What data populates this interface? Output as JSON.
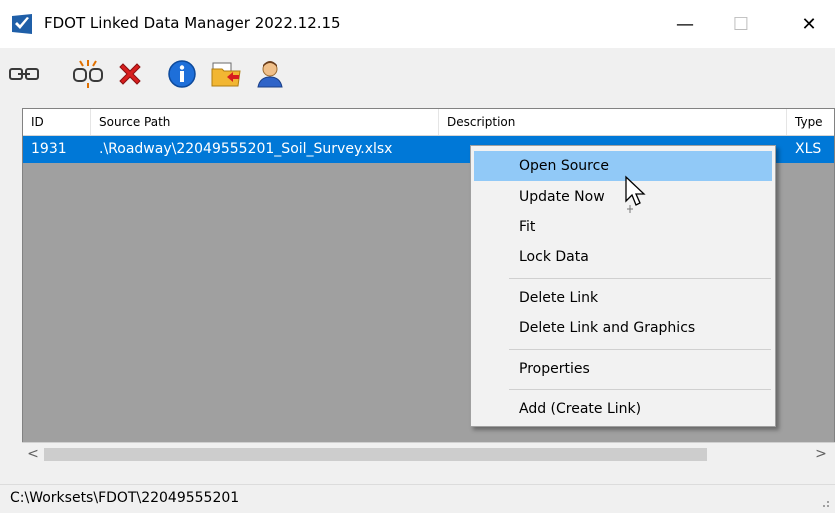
{
  "window": {
    "title": "FDOT Linked Data Manager 2022.12.15"
  },
  "titlebar_buttons": {
    "minimize": "—",
    "maximize": "☐",
    "close": "✕"
  },
  "toolbar": {
    "icons": [
      "link-icon",
      "break-link-icon",
      "delete-icon",
      "info-icon",
      "open-folder-icon",
      "user-icon"
    ]
  },
  "table": {
    "columns": [
      "ID",
      "Source Path",
      "Description",
      "Type"
    ],
    "rows": [
      {
        "id": "1931",
        "source_path": ".\\Roadway\\22049555201_Soil_Survey.xlsx",
        "description": "",
        "type": "XLS"
      }
    ]
  },
  "scrollbar": {
    "left_arrow": "<",
    "right_arrow": ">"
  },
  "context_menu": {
    "items": [
      "Open Source",
      "Update Now",
      "Fit",
      "Lock Data",
      "Delete Link",
      "Delete Link and Graphics",
      "Properties",
      "Add (Create Link)"
    ],
    "highlighted": "Open Source"
  },
  "status": {
    "path": "C:\\Worksets\\FDOT\\22049555201"
  },
  "colors": {
    "selection": "#0078d7",
    "menu_highlight": "#91c9f7",
    "list_background": "#a0a0a0"
  }
}
